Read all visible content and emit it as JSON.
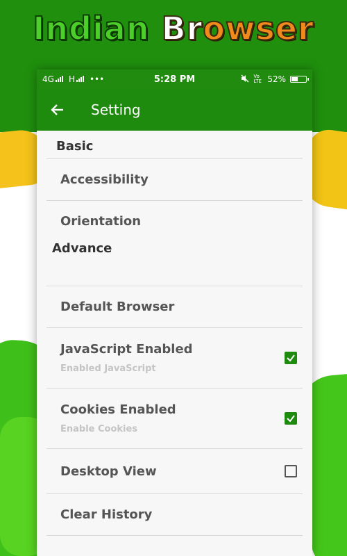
{
  "promo": {
    "headline_part1": "Indian",
    "headline_part2_a": "Br",
    "headline_part2_b": "o",
    "headline_part2_c": "wser"
  },
  "statusbar": {
    "network1": "4G",
    "network2": "H",
    "dots": "•••",
    "time": "5:28 PM",
    "volte": "Vo LTE",
    "battery": "52%",
    "battery_level": 0.52
  },
  "appbar": {
    "title": "Setting",
    "back_icon": "arrow-left-icon"
  },
  "sections": [
    {
      "header": "Basic",
      "items": [
        {
          "title": "Accessibility"
        },
        {
          "title": "Orientation"
        }
      ]
    },
    {
      "header": "Advance",
      "items": [
        {
          "title": "Default Browser"
        },
        {
          "title": "JavaScript Enabled",
          "subtitle": "Enabled JavaScript",
          "checked": true
        },
        {
          "title": "Cookies Enabled",
          "subtitle": "Enable Cookies",
          "checked": true
        },
        {
          "title": "Desktop View",
          "checked": false
        },
        {
          "title": "Clear History"
        }
      ]
    }
  ],
  "colors": {
    "primary": "#1e8a0e",
    "saffron": "#f08a1c",
    "text": "#555555",
    "subtext": "#c4c4c4"
  }
}
